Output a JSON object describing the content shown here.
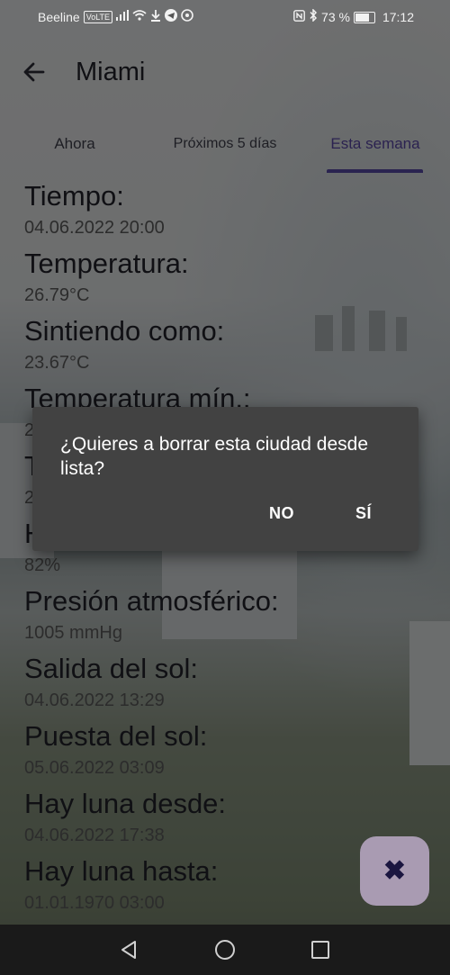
{
  "status_bar": {
    "carrier": "Beeline",
    "volte": "VoLTE",
    "battery_percent": "73 %",
    "battery_level": 0.73,
    "time": "17:12",
    "icons": [
      "signal-icon",
      "wifi-icon",
      "download-icon",
      "telegram-icon",
      "whatsapp-icon",
      "nfc-icon",
      "bluetooth-icon",
      "battery-icon"
    ]
  },
  "app_bar": {
    "back_icon": "arrow-left-icon",
    "title": "Miami"
  },
  "tabs": [
    {
      "label": "Ahora",
      "active": false
    },
    {
      "label": "Próximos 5 días",
      "active": false
    },
    {
      "label": "Esta semana",
      "active": true
    }
  ],
  "weather": [
    {
      "label": "Tiempo:",
      "value": "04.06.2022 20:00"
    },
    {
      "label": "Temperatura:",
      "value": "26.79°C"
    },
    {
      "label": "Sintiendo como:",
      "value": "23.67°C"
    },
    {
      "label": "Temperatura mín.:",
      "value": "2"
    },
    {
      "label": "T",
      "value": "2"
    },
    {
      "label": "H",
      "value": "82%"
    },
    {
      "label": "Presión atmosférico:",
      "value": "1005 mmHg"
    },
    {
      "label": "Salida del sol:",
      "value": "04.06.2022 13:29"
    },
    {
      "label": "Puesta del sol:",
      "value": "05.06.2022 03:09"
    },
    {
      "label": "Hay luna desde:",
      "value": "04.06.2022 17:38"
    },
    {
      "label": "Hay luna hasta:",
      "value": "01.01.1970 03:00"
    }
  ],
  "dialog": {
    "message": "¿Quieres a borrar esta ciudad desde lista?",
    "no_label": "NO",
    "yes_label": "SÍ"
  },
  "fab": {
    "icon": "close-icon",
    "glyph": "✖"
  },
  "colors": {
    "dialog_bg": "#424242",
    "fab_bg": "#a99bb2",
    "tab_indicator": "#2a2350",
    "navbar_bg": "#1a1a1a"
  }
}
